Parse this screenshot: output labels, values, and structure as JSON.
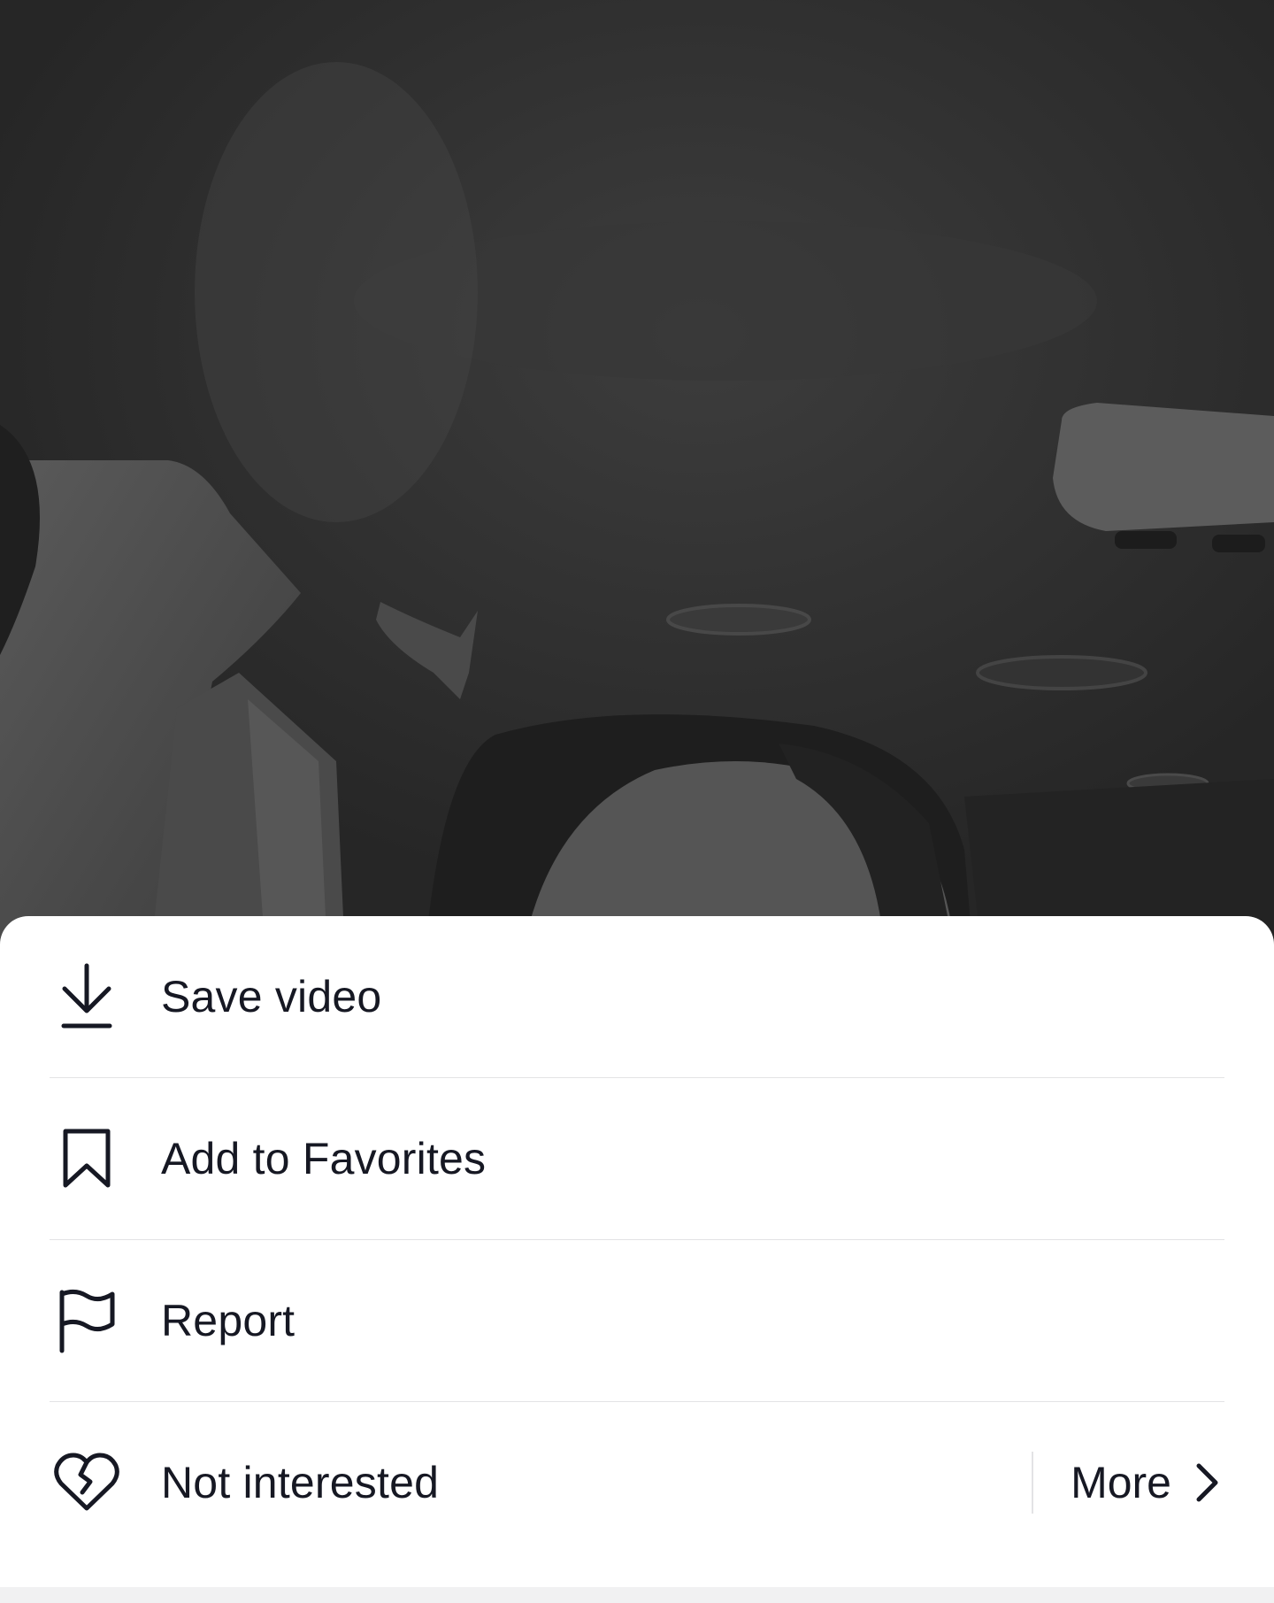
{
  "video": {
    "description_icon": "car-interior-video-frame"
  },
  "sheet": {
    "items": [
      {
        "label": "Save video",
        "icon": "download-icon"
      },
      {
        "label": "Add to Favorites",
        "icon": "bookmark-icon"
      },
      {
        "label": "Report",
        "icon": "flag-icon"
      },
      {
        "label": "Not interested",
        "icon": "broken-heart-icon"
      }
    ],
    "more": {
      "label": "More",
      "icon": "chevron-right-icon"
    }
  },
  "colors": {
    "text": "#161823",
    "divider": "#e3e3e5",
    "sheet_bg": "#ffffff",
    "backdrop": "#2b2b2b"
  }
}
